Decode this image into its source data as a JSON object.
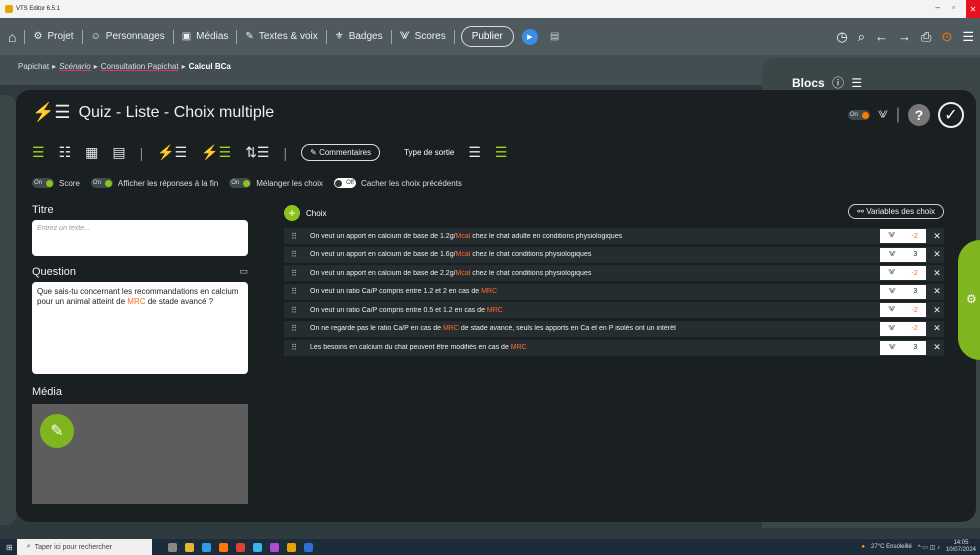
{
  "window": {
    "title": "VTS Editor 6.5.1"
  },
  "topnav": {
    "projet": "Projet",
    "personnages": "Personnages",
    "medias": "Médias",
    "textes": "Textes & voix",
    "badges": "Badges",
    "scores": "Scores",
    "publier": "Publier"
  },
  "breadcrumb": [
    "Papichat",
    "Scénario",
    "Consultation Papichat",
    "Calcul BCa"
  ],
  "blocs": {
    "title": "Blocs"
  },
  "modal": {
    "title": "Quiz - Liste - Choix multiple",
    "toolbar": {
      "commentaires": "Commentaires",
      "type_sortie": "Type de sortie"
    },
    "options": [
      {
        "state": "On",
        "label": "Score"
      },
      {
        "state": "On",
        "label": "Afficher les réponses à la fin"
      },
      {
        "state": "On",
        "label": "Mélanger les choix"
      },
      {
        "state": "Off",
        "label": "Cacher les choix précédents"
      }
    ],
    "titre": {
      "label": "Titre",
      "placeholder": "Entrez un texte..."
    },
    "question": {
      "label": "Question",
      "text_before": "Que sais-tu concernant les recommandations en calcium pour un animal atteint de ",
      "highlight": "MRC",
      "text_after": " de stade avancé ?"
    },
    "media": {
      "label": "Média"
    },
    "choix": {
      "label": "Choix",
      "variables": "Variables des choix",
      "items": [
        {
          "before": "On veut un apport en calcium de base de 1.2g/",
          "hl": "Mcal",
          "after": " chez le chat adulte en conditions physiologiques",
          "score": "-2"
        },
        {
          "before": "On veut un apport en calcium de base de 1.6g/",
          "hl": "Mcal",
          "after": " chez le chat conditions physiologiques",
          "score": "3"
        },
        {
          "before": "On veut un apport en calcium de base de 2.2g/",
          "hl": "Mcal",
          "after": " chez le chat conditions physiologiques",
          "score": "-2"
        },
        {
          "before": "On veut un ratio Ca/P compris entre 1.2 et 2 en cas de ",
          "hl": "MRC",
          "after": "",
          "score": "3"
        },
        {
          "before": "On veut un ratio Ca/P compris entre 0.5 et 1.2 en cas de ",
          "hl": "MRC",
          "after": "",
          "score": "-2"
        },
        {
          "before": "On ne regarde pas le ratio Ca/P en cas de ",
          "hl": "MRC",
          "after": " de stade avancé, seuls les apports en Ca et en P isolés ont un intérêt",
          "score": "-2"
        },
        {
          "before": "Les besoins en calcium du chat peuvent être modifiés en cas de ",
          "hl": "MRC",
          "after": "",
          "score": "3"
        }
      ]
    }
  },
  "taskbar": {
    "search": "Taper ici pour rechercher",
    "weather": "27°C Ensoleillé",
    "time": "14:05",
    "date": "10/07/2024"
  },
  "colors": {
    "accent_green": "#8cc21d",
    "highlight_orange": "#ff6a2b",
    "score_negative": "#ff6a2b"
  }
}
